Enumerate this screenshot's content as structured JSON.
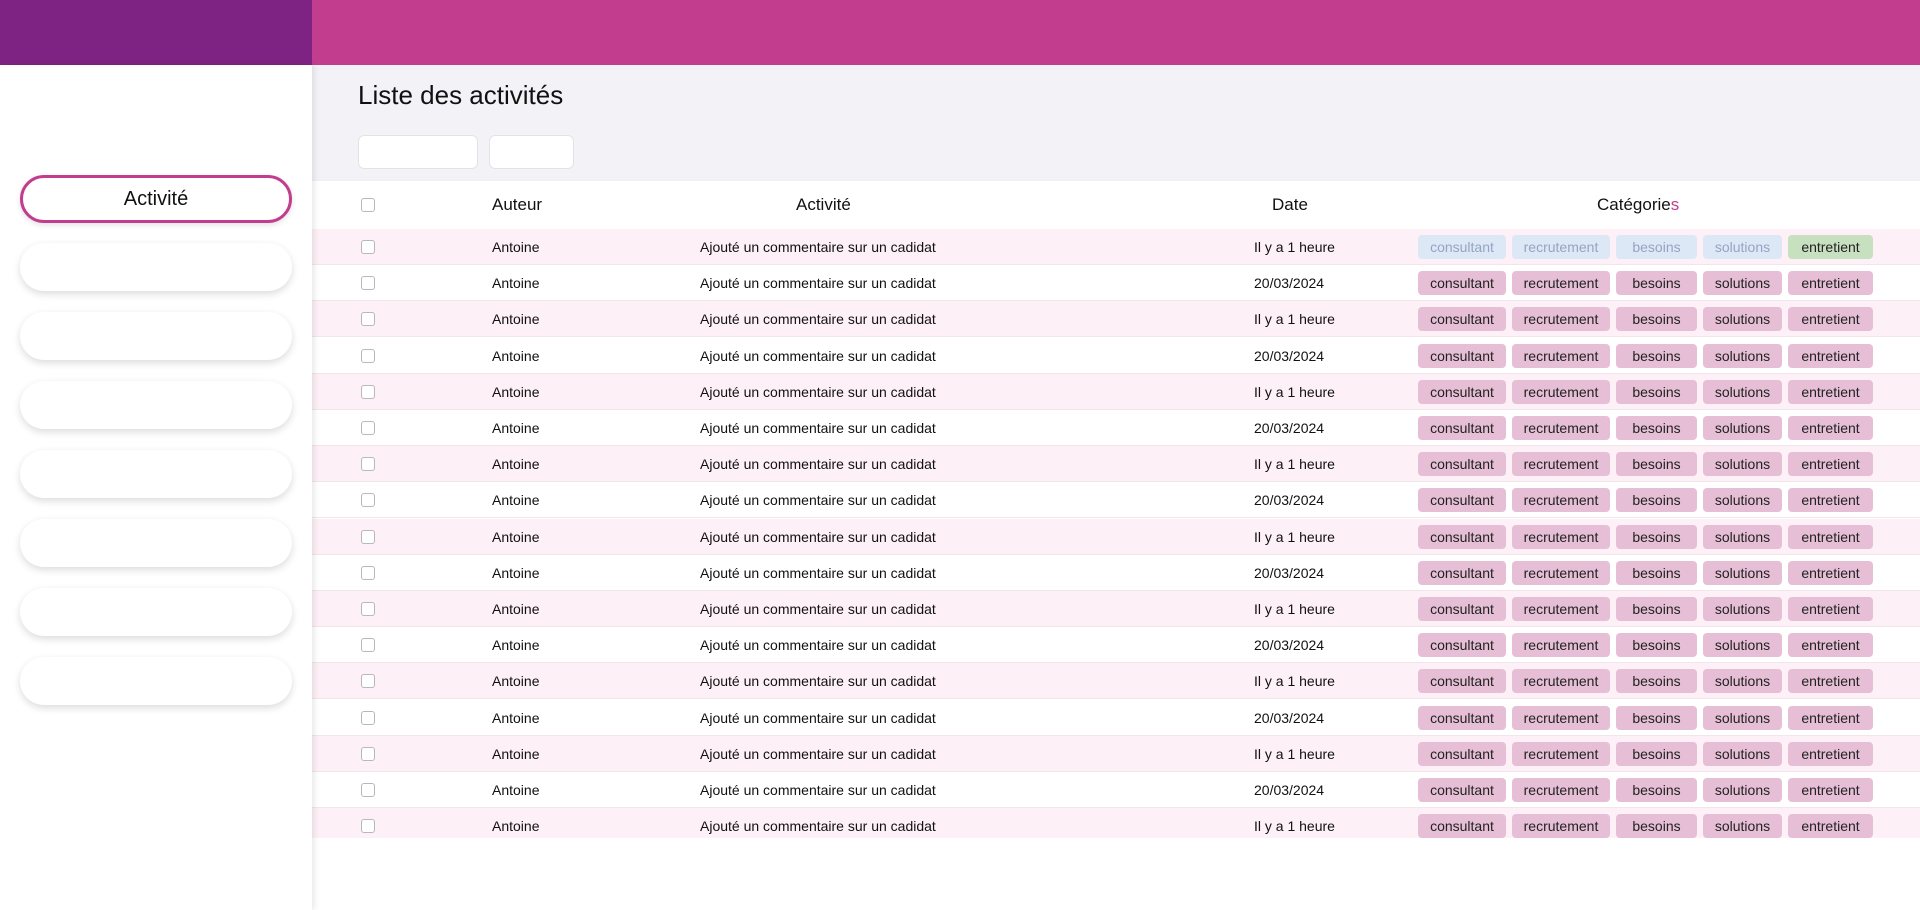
{
  "sidebar": {
    "items": [
      {
        "label": "Activité",
        "active": true
      },
      {
        "label": ""
      },
      {
        "label": ""
      },
      {
        "label": ""
      },
      {
        "label": ""
      },
      {
        "label": ""
      },
      {
        "label": ""
      },
      {
        "label": ""
      }
    ]
  },
  "main": {
    "title": "Liste des activités",
    "filters": [
      "",
      ""
    ]
  },
  "table": {
    "headers": {
      "author": "Auteur",
      "activity": "Activité",
      "date": "Date",
      "categories_main": "Catégorie",
      "categories_accent": "s"
    },
    "tags": [
      "consultant",
      "recrutement",
      "besoins",
      "solutions",
      "entretient"
    ],
    "rows": [
      {
        "author": "Antoine",
        "activity": "Ajouté un commentaire sur un cadidat",
        "date": "Il y a 1 heure"
      },
      {
        "author": "Antoine",
        "activity": "Ajouté un commentaire sur un cadidat",
        "date": "20/03/2024"
      },
      {
        "author": "Antoine",
        "activity": "Ajouté un commentaire sur un cadidat",
        "date": "Il y a 1 heure"
      },
      {
        "author": "Antoine",
        "activity": "Ajouté un commentaire sur un cadidat",
        "date": "20/03/2024"
      },
      {
        "author": "Antoine",
        "activity": "Ajouté un commentaire sur un cadidat",
        "date": "Il y a 1 heure"
      },
      {
        "author": "Antoine",
        "activity": "Ajouté un commentaire sur un cadidat",
        "date": "20/03/2024"
      },
      {
        "author": "Antoine",
        "activity": "Ajouté un commentaire sur un cadidat",
        "date": "Il y a 1 heure"
      },
      {
        "author": "Antoine",
        "activity": "Ajouté un commentaire sur un cadidat",
        "date": "20/03/2024"
      },
      {
        "author": "Antoine",
        "activity": "Ajouté un commentaire sur un cadidat",
        "date": "Il y a 1 heure"
      },
      {
        "author": "Antoine",
        "activity": "Ajouté un commentaire sur un cadidat",
        "date": "20/03/2024"
      },
      {
        "author": "Antoine",
        "activity": "Ajouté un commentaire sur un cadidat",
        "date": "Il y a 1 heure"
      },
      {
        "author": "Antoine",
        "activity": "Ajouté un commentaire sur un cadidat",
        "date": "20/03/2024"
      },
      {
        "author": "Antoine",
        "activity": "Ajouté un commentaire sur un cadidat",
        "date": "Il y a 1 heure"
      },
      {
        "author": "Antoine",
        "activity": "Ajouté un commentaire sur un cadidat",
        "date": "20/03/2024"
      },
      {
        "author": "Antoine",
        "activity": "Ajouté un commentaire sur un cadidat",
        "date": "Il y a 1 heure"
      },
      {
        "author": "Antoine",
        "activity": "Ajouté un commentaire sur un cadidat",
        "date": "20/03/2024"
      },
      {
        "author": "Antoine",
        "activity": "Ajouté un commentaire sur un cadidat",
        "date": "Il y a 1 heure"
      }
    ]
  },
  "colors": {
    "brand_purple": "#7e2383",
    "brand_pink": "#c23d8d",
    "tag_pink": "#e6bfd6",
    "tag_light": "#dde8f7",
    "tag_green": "#c7e0c0",
    "row_pink": "#fdf0f6"
  }
}
